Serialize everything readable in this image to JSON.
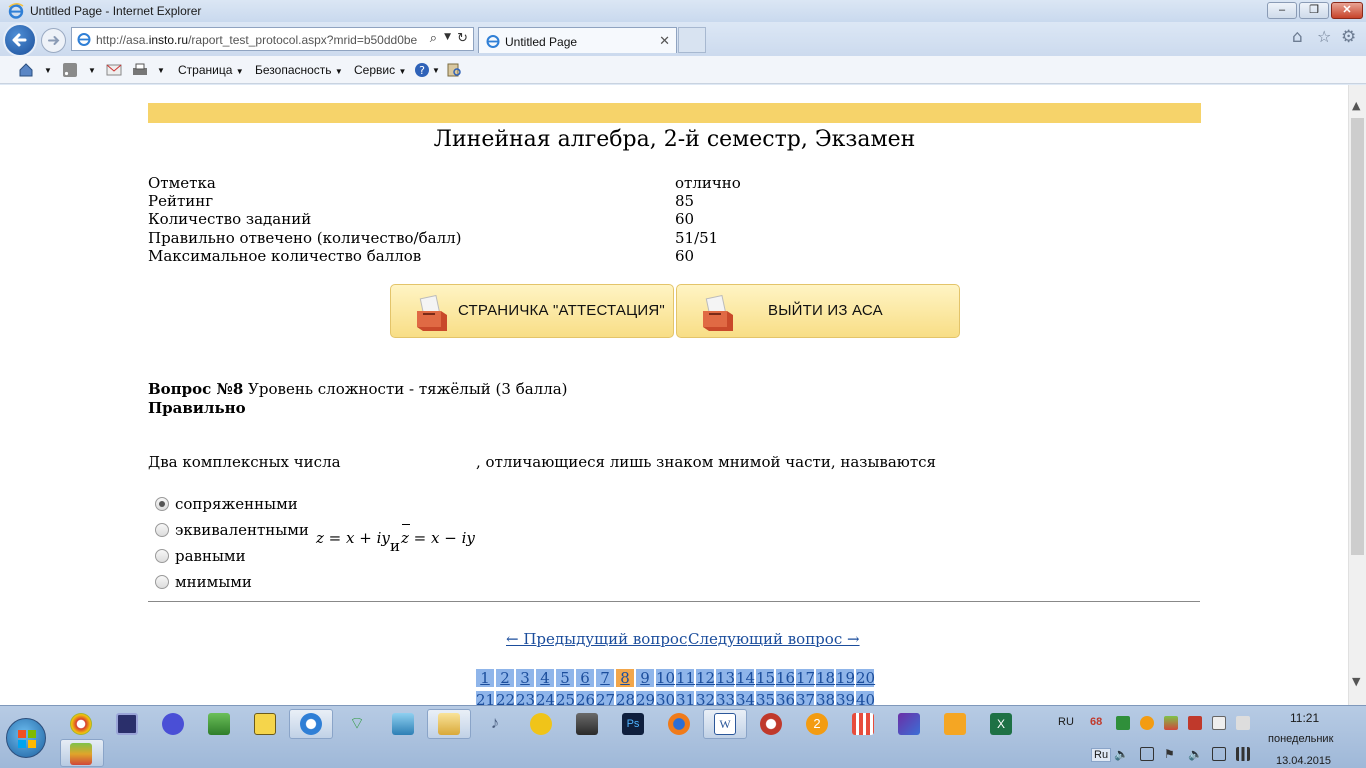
{
  "window": {
    "title": "Untitled Page - Internet Explorer",
    "controls": [
      "‒",
      "❐",
      "✕"
    ]
  },
  "navbar": {
    "url_prefix": "http://asa.",
    "url_host": "insto.ru",
    "url_path": "/raport_test_protocol.aspx?mrid=b50dd0be",
    "tab_label": "Untitled Page"
  },
  "command_bar": {
    "page_menu": "Страница",
    "safety_menu": "Безопасность",
    "tools_menu": "Сервис"
  },
  "page": {
    "title": "Линейная алгебра, 2-й семестр, Экзамен",
    "stats": [
      {
        "label": "Отметка",
        "value": "отлично"
      },
      {
        "label": "Рейтинг",
        "value": "85"
      },
      {
        "label": "Количество заданий",
        "value": "60"
      },
      {
        "label": "Правильно отвечено (количество/балл)",
        "value": "51/51"
      },
      {
        "label": "Максимальное количество баллов",
        "value": "60"
      }
    ],
    "buttons": {
      "attestation": "СТРАНИЧКА \"АТТЕСТАЦИЯ\"",
      "exit": "ВЫЙТИ ИЗ АСА"
    },
    "question": {
      "number_label": "Вопрос №8",
      "difficulty": "Уровень сложности - тяжёлый (3 балла)",
      "status": "Правильно",
      "text_before": "Два комплексных числа",
      "formula_1": "z = x + iy",
      "conjunction": "и",
      "formula_2": "z = x − iy",
      "text_after": ", отличающиеся лишь знаком мнимой части, называются",
      "options": [
        {
          "label": "сопряженными",
          "selected": true
        },
        {
          "label": "эквивалентными",
          "selected": false
        },
        {
          "label": "равными",
          "selected": false
        },
        {
          "label": "мнимыми",
          "selected": false
        }
      ]
    },
    "nav": {
      "prev": "← Предыдущий вопрос",
      "next": "Следующий вопрос →"
    },
    "question_numbers_row1": [
      "1",
      "2",
      "3",
      "4",
      "5",
      "6",
      "7",
      "8",
      "9",
      "10",
      "11",
      "12",
      "13",
      "14",
      "15",
      "16",
      "17",
      "18",
      "19",
      "20"
    ],
    "question_numbers_row2": [
      "21",
      "22",
      "23",
      "24",
      "25",
      "26",
      "27",
      "28",
      "29",
      "30",
      "31",
      "32",
      "33",
      "34",
      "35",
      "36",
      "37",
      "38",
      "39",
      "40"
    ],
    "current_question": "8"
  },
  "taskbar": {
    "language": "RU",
    "language_small": "Ru",
    "badge": "68",
    "time": "11:21",
    "weekday": "понедельник",
    "date": "13.04.2015"
  },
  "colors": {
    "accent_yellow": "#f6d36a",
    "qcell_blue": "#8fb5ea",
    "qcell_current": "#f2a64a",
    "link": "#1b4d9c"
  }
}
